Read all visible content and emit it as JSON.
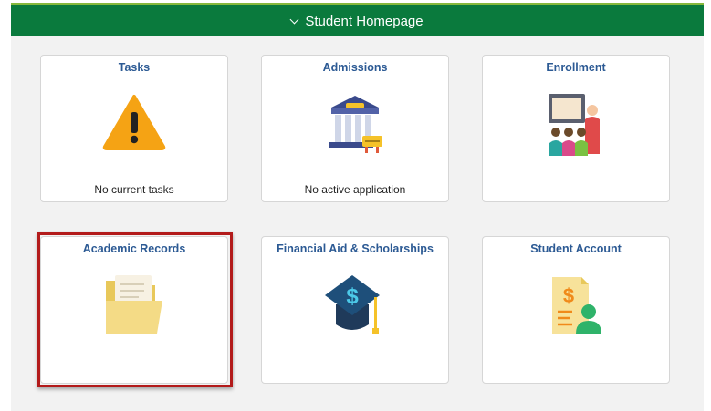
{
  "header": {
    "title": "Student Homepage"
  },
  "tiles": [
    {
      "title": "Tasks",
      "status": "No current tasks"
    },
    {
      "title": "Admissions",
      "status": "No active application"
    },
    {
      "title": "Enrollment",
      "status": ""
    },
    {
      "title": "Academic Records",
      "status": ""
    },
    {
      "title": "Financial Aid & Scholarships",
      "status": ""
    },
    {
      "title": "Student Account",
      "status": ""
    }
  ],
  "colors": {
    "header_bg": "#0a7a3d",
    "header_accent": "#86b83c",
    "tile_title": "#2c5a94",
    "highlight_border": "#b31b1b",
    "content_bg": "#f2f2f2"
  },
  "icons": {
    "tasks": "warning-icon",
    "admissions": "institution-building-icon",
    "enrollment": "classroom-icon",
    "academic_records": "folder-icon",
    "financial_aid": "graduation-cap-dollar-icon",
    "student_account": "billing-document-user-icon"
  }
}
